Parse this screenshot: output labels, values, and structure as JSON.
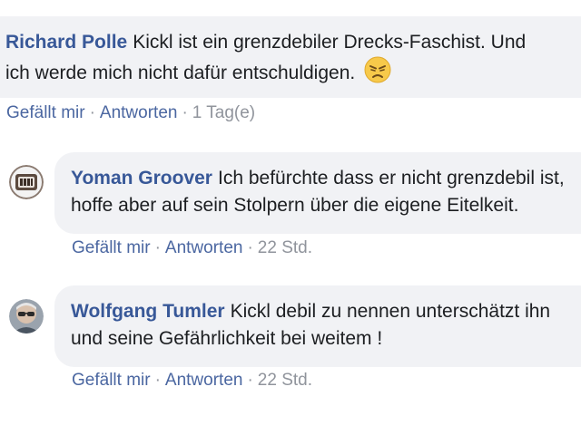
{
  "comments": [
    {
      "author": "Richard Polle",
      "text_line1": "Kickl ist ein grenzdebiler Drecks-Faschist. Und",
      "text_line2": "ich werde mich nicht dafür entschuldigen.",
      "emoji": "angry-face-emoji",
      "like": "Gefällt mir",
      "reply": "Antworten",
      "time": "1 Tag(e)"
    },
    {
      "author": "Yoman Groover",
      "text_line1": "Ich befürchte dass er nicht grenzdebil ist,",
      "text_line2": "hoffe aber auf sein Stolpern über die eigene Eitelkeit.",
      "avatar": "avatar-icon",
      "like": "Gefällt mir",
      "reply": "Antworten",
      "time": "22 Std."
    },
    {
      "author": "Wolfgang Tumler",
      "text_line1": "Kickl debil zu nennen unterschätzt ihn",
      "text_line2": "und seine Gefährlichkeit bei weitem !",
      "avatar": "avatar-icon",
      "like": "Gefällt mir",
      "reply": "Antworten",
      "time": "22 Std."
    }
  ],
  "separator": "·",
  "colors": {
    "author": "#385898",
    "link": "#4b67a1",
    "meta": "#90949c",
    "bubble": "#f1f2f5",
    "text": "#1c1e21"
  }
}
